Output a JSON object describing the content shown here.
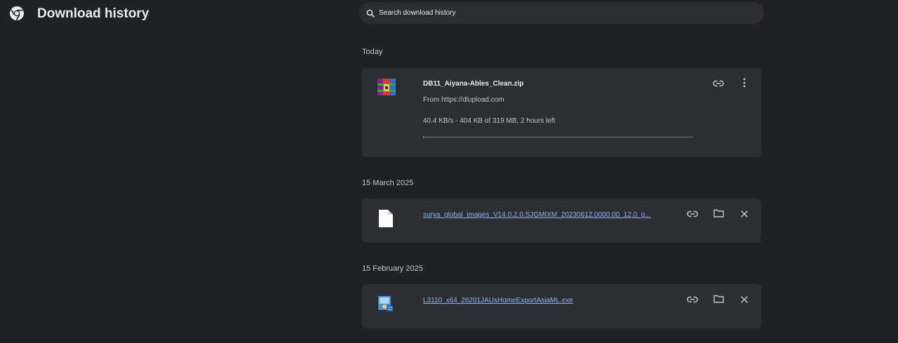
{
  "app": {
    "title": "Download history",
    "logo_icon": "chrome-icon"
  },
  "search": {
    "placeholder": "Search download history",
    "icon": "search-icon"
  },
  "sections": [
    {
      "date": "Today",
      "items": [
        {
          "name": "DB11_Aiyana-Ables_Clean.zip",
          "source": "From https://dlupload.com",
          "status": "40.4 KB/s - 404 KB of 319 MB, 2 hours left",
          "progress": 0.0013,
          "icon": "winrar-archive-icon",
          "actions": [
            "link-icon",
            "more-vert-icon"
          ]
        }
      ]
    },
    {
      "date": "15 March 2025",
      "items": [
        {
          "name": "surya_global_images_V14.0.2.0.SJGMIXM_20230612.0000.00_12.0_g...",
          "icon": "blank-file-icon",
          "actions": [
            "link-icon",
            "folder-icon",
            "close-icon"
          ]
        }
      ]
    },
    {
      "date": "15 February 2025",
      "items": [
        {
          "name": "L3110_x64_26201JAUsHomeExportAsiaML.exe",
          "icon": "installer-exe-icon",
          "actions": [
            "link-icon",
            "folder-icon",
            "close-icon"
          ]
        }
      ]
    }
  ],
  "colors": {
    "background": "#202124",
    "card": "#2d2e31",
    "link": "#8ab4f8",
    "progress_fill": "#8ab4f8"
  }
}
